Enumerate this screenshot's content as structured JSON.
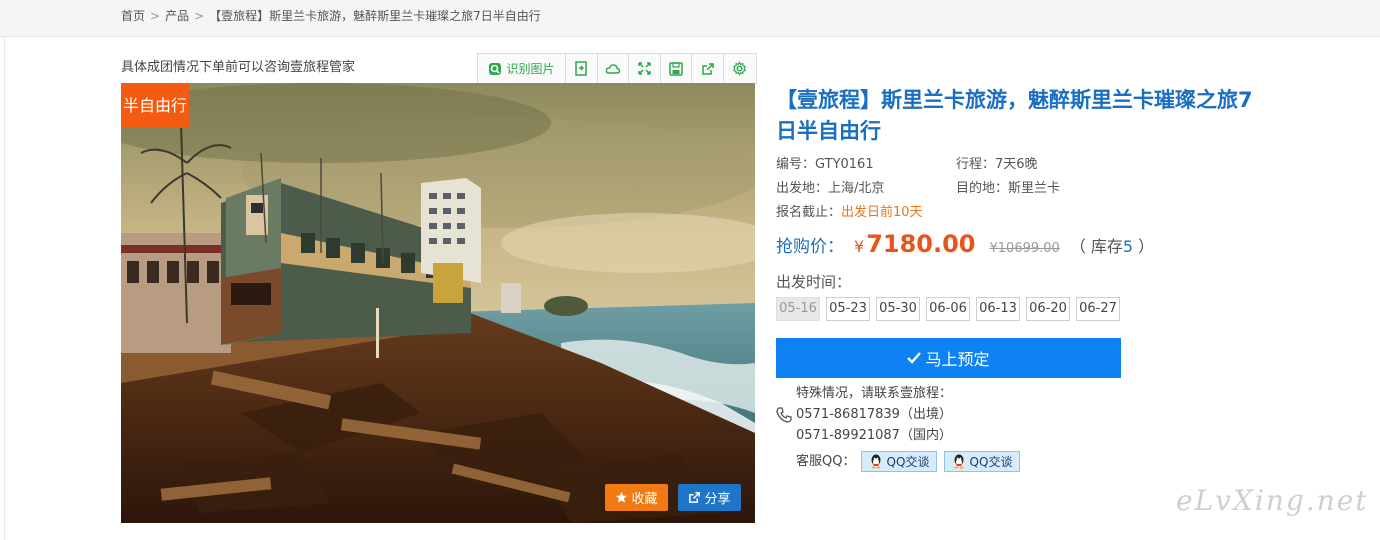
{
  "breadcrumb": {
    "home": "首页",
    "sep1": ">",
    "products": "产品",
    "sep2": ">",
    "current": "【壹旅程】斯里兰卡旅游，魅醉斯里兰卡璀璨之旅7日半自由行"
  },
  "gallery": {
    "caption": "具体成团情况下单前可以咨询壹旅程管家",
    "toolbar": {
      "recognize_label": "识别图片",
      "icons": [
        "export-icon",
        "cloud-icon",
        "fullscreen-icon",
        "save-icon",
        "share-out-icon",
        "settings-icon"
      ]
    },
    "tag": "半自由行",
    "fav_label": "收藏",
    "share_label": "分享"
  },
  "product": {
    "title": "【壹旅程】斯里兰卡旅游，魅醉斯里兰卡璀璨之旅7日半自由行",
    "code_label": "编号：",
    "code": "GTY0161",
    "duration_label": "行程：",
    "duration": "7天6晚",
    "depart_label": "出发地：",
    "depart": "上海/北京",
    "dest_label": "目的地：",
    "dest": "斯里兰卡",
    "deadline_label": "报名截止：",
    "deadline": "出发日前10天"
  },
  "price": {
    "label": "抢购价：",
    "currency": "¥",
    "value": "7180.00",
    "original": "¥10699.00",
    "stock_prefix": "（ 库存",
    "stock": "5",
    "stock_suffix": " ）"
  },
  "dates": {
    "label": "出发时间：",
    "items": [
      "05-16",
      "05-23",
      "05-30",
      "06-06",
      "06-13",
      "06-20",
      "06-27"
    ],
    "disabled_index": 0
  },
  "booking": {
    "button_label": "马上预定"
  },
  "contact": {
    "intro": "特殊情况，请联系壹旅程：",
    "phone1": "0571-86817839（出境）",
    "phone2": "0571-89921087（国内）",
    "qq_label": "客服QQ：",
    "qq_btn1": "QQ交谈",
    "qq_btn2": "QQ交谈"
  },
  "watermark": "eLvXing.net",
  "colors": {
    "accent_blue": "#1b6fc2",
    "booking_blue": "#0e82f3",
    "price_red": "#e8541e",
    "tag_orange": "#f45a10",
    "toolbar_green": "#2aa84a"
  }
}
